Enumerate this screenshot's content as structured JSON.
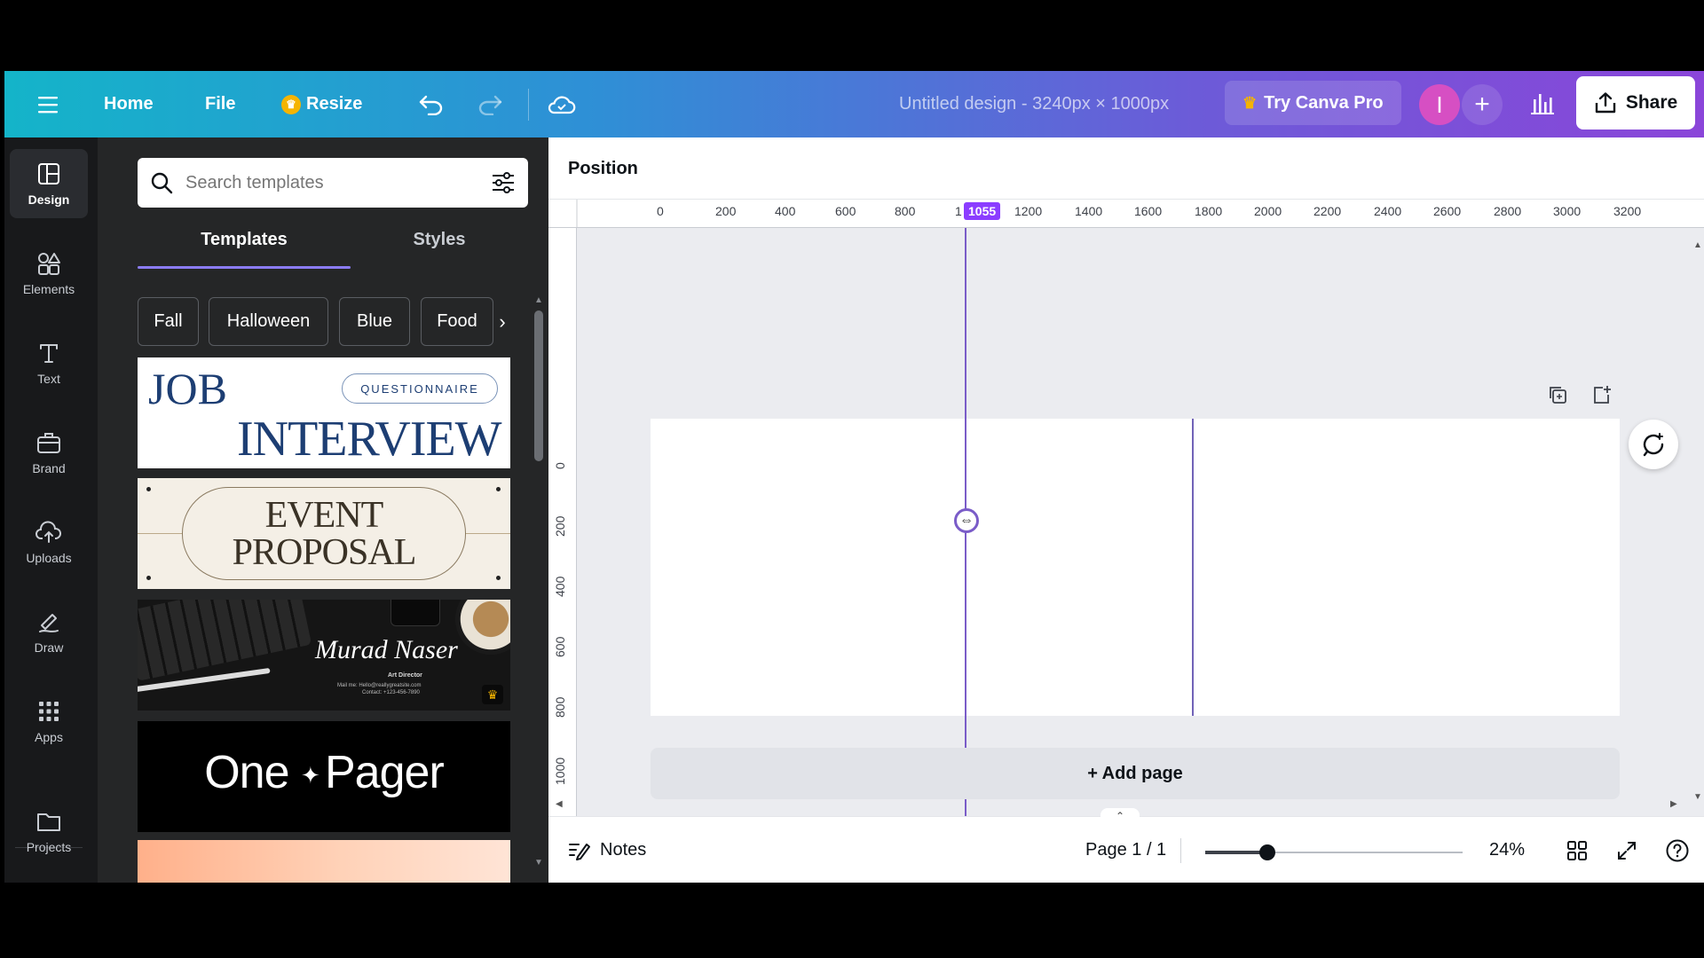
{
  "topbar": {
    "home": "Home",
    "file": "File",
    "resize": "Resize",
    "doc_title": "Untitled design - 3240px × 1000px",
    "try_pro": "Try Canva Pro",
    "avatar_letter": "I",
    "share": "Share",
    "accent": "#8b3dff"
  },
  "rail": {
    "items": [
      {
        "label": "Design",
        "icon": "layout-icon"
      },
      {
        "label": "Elements",
        "icon": "shapes-icon"
      },
      {
        "label": "Text",
        "icon": "text-icon"
      },
      {
        "label": "Brand",
        "icon": "briefcase-icon"
      },
      {
        "label": "Uploads",
        "icon": "cloud-upload-icon"
      },
      {
        "label": "Draw",
        "icon": "pen-icon"
      },
      {
        "label": "Apps",
        "icon": "grid-icon"
      },
      {
        "label": "Projects",
        "icon": "folder-icon"
      }
    ]
  },
  "panel": {
    "search_placeholder": "Search templates",
    "tabs": [
      "Templates",
      "Styles"
    ],
    "chips": [
      "Fall",
      "Halloween",
      "Blue",
      "Food"
    ],
    "templates": [
      {
        "line1": "JOB",
        "line2": "INTERVIEW",
        "badge": "QUESTIONNAIRE"
      },
      {
        "line1": "EVENT",
        "line2": "PROPOSAL"
      },
      {
        "script": "Murad Naser",
        "role": "Art Director",
        "contact1": "Mail me: Hello@reallygreatsite.com",
        "contact2": "Contact: +123-456-7890"
      },
      {
        "text_left": "One",
        "text_right": "Pager"
      }
    ]
  },
  "context": {
    "label": "Position"
  },
  "ruler": {
    "h_labels": [
      "0",
      "200",
      "400",
      "600",
      "800",
      "1",
      "1200",
      "1400",
      "1600",
      "1800",
      "2000",
      "2200",
      "2400",
      "2600",
      "2800",
      "3000",
      "3200"
    ],
    "guide_value": "1055",
    "v_labels": [
      "0",
      "200",
      "400",
      "600",
      "800",
      "1000"
    ]
  },
  "canvas": {
    "add_page": "+ Add page"
  },
  "footer": {
    "notes": "Notes",
    "page": "Page 1 / 1",
    "zoom": "24%",
    "zoom_fraction": 0.24
  }
}
